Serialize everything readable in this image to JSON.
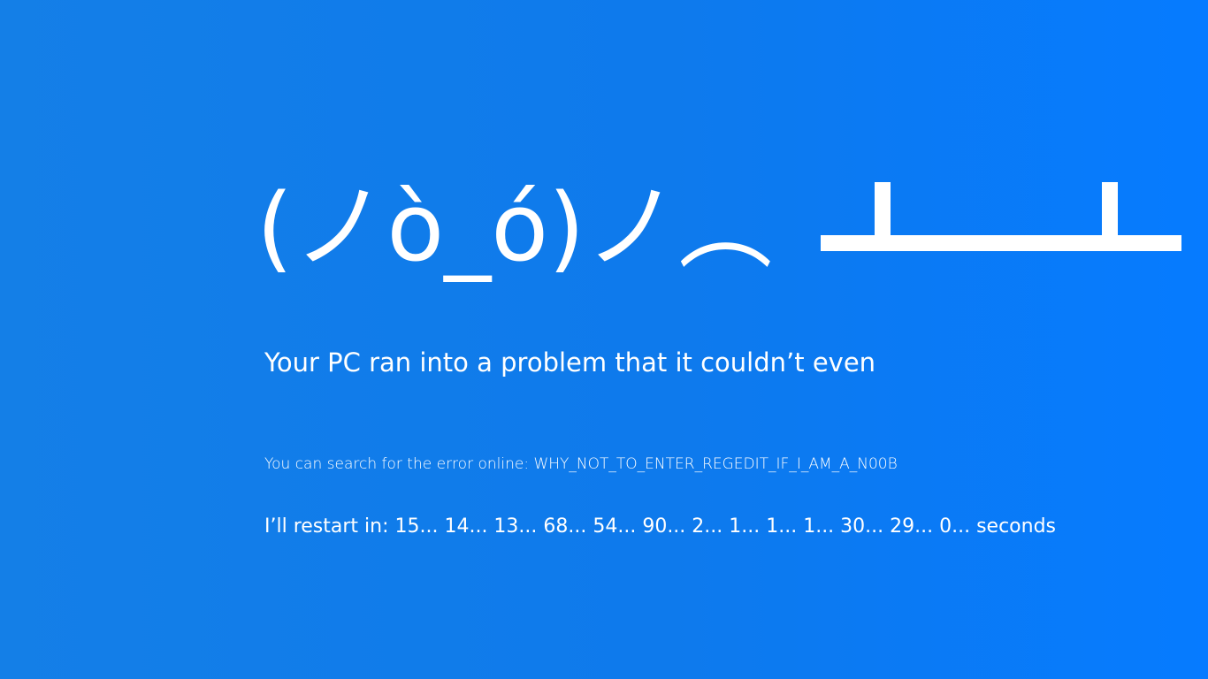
{
  "screen": {
    "background_color": "#0f7bee",
    "text_color": "#ffffff",
    "emoticon": "(ノò_ó)ノ︵",
    "flipped_table": "┻━┻",
    "title": "Your PC ran into a problem that it couldn’t even",
    "search_line": "You can search for the error online: WHY_NOT_TO_ENTER_REGEDIT_IF_I_AM_A_N00B",
    "restart_line": "I’ll restart in: 15... 14... 13... 68... 54... 90... 2... 1... 1... 1... 30... 29... 0... seconds"
  }
}
